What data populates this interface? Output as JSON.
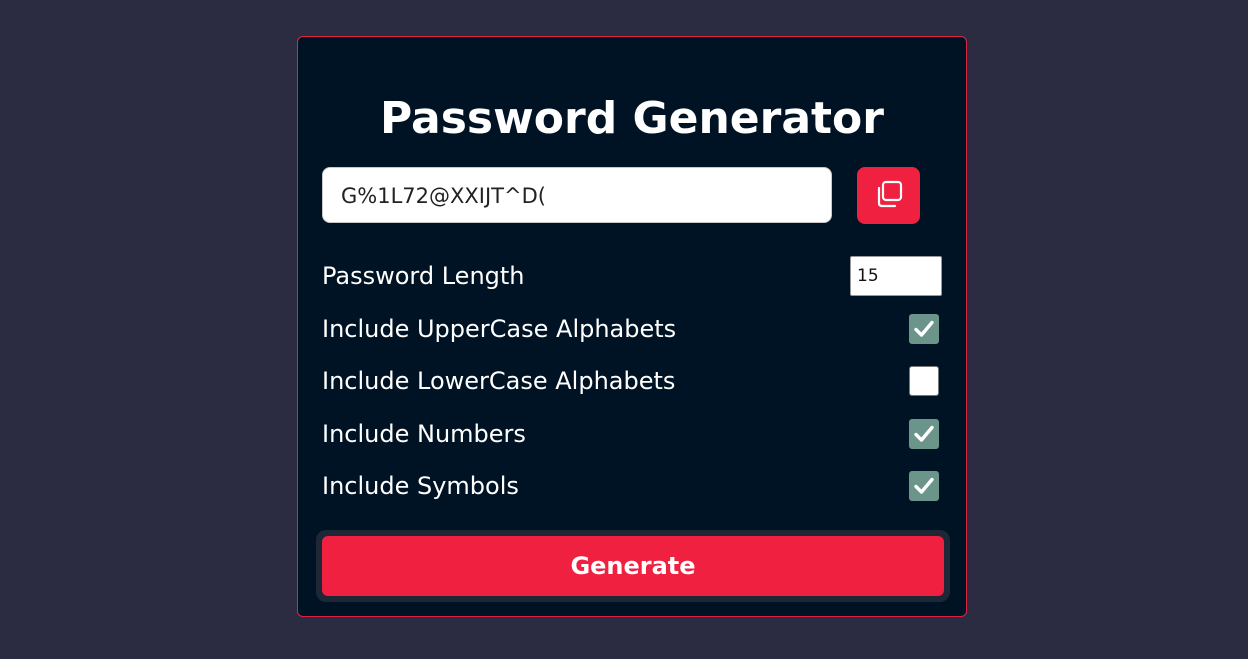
{
  "app": {
    "title": "Password Generator"
  },
  "password": {
    "value": "G%1L72@XXIJT^D("
  },
  "copy_button": {
    "icon": "copy-icon"
  },
  "options": {
    "length_label": "Password Length",
    "length_value": "15",
    "uppercase_label": "Include UpperCase Alphabets",
    "uppercase_checked": true,
    "lowercase_label": "Include LowerCase Alphabets",
    "lowercase_checked": false,
    "numbers_label": "Include Numbers",
    "numbers_checked": true,
    "symbols_label": "Include Symbols",
    "symbols_checked": true
  },
  "generate_button": {
    "label": "Generate"
  },
  "colors": {
    "background": "#2b2c42",
    "card": "#001324",
    "accent": "#ef2040",
    "checkbox_checked": "#6b948a"
  }
}
